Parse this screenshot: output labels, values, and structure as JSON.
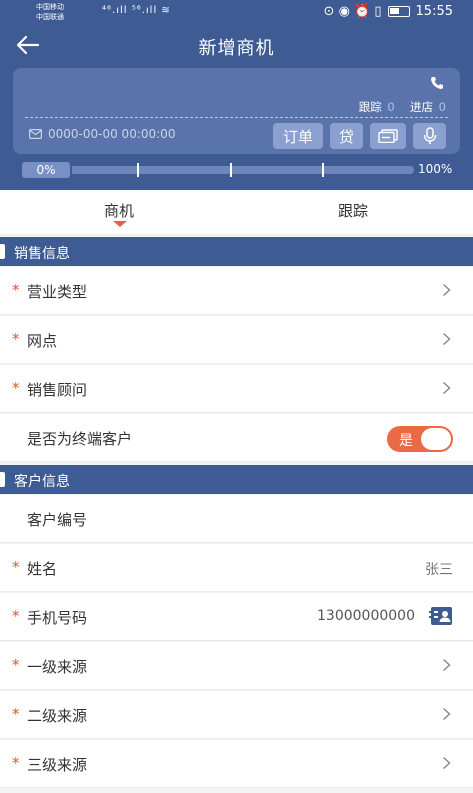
{
  "statusbar": {
    "carrier1": "中国移动",
    "carrier2": "中国联通",
    "signal_icons": "⁴⁶.ıll ⁵⁶.ıll ≋",
    "right_icons": "⊙ ◉ ⏰ ▯",
    "time": "15:55"
  },
  "header": {
    "title": "新增商机"
  },
  "card": {
    "follow_label": "跟踪",
    "follow_count": "0",
    "visit_label": "进店",
    "visit_count": "0",
    "datetime": "0000-00-00 00:00:00",
    "btn_order": "订单",
    "btn_loan": "贷"
  },
  "progress": {
    "start_label": "0%",
    "end_label": "100%",
    "value": 0
  },
  "tabs": [
    {
      "label": "商机",
      "active": true
    },
    {
      "label": "跟踪",
      "active": false
    }
  ],
  "sections": {
    "sales": "销售信息",
    "customer": "客户信息"
  },
  "rows": {
    "business_type": {
      "label": "营业类型",
      "required": "*"
    },
    "outlet": {
      "label": "网点",
      "required": "*"
    },
    "consultant": {
      "label": "销售顾问",
      "required": "*"
    },
    "end_customer": {
      "label": "是否为终端客户",
      "toggle_label": "是"
    },
    "customer_no": {
      "label": "客户编号"
    },
    "name": {
      "label": "姓名",
      "required": "*",
      "value": "张三"
    },
    "phone": {
      "label": "手机号码",
      "required": "*",
      "value": "13000000000"
    },
    "source1": {
      "label": "一级来源",
      "required": "*"
    },
    "source2": {
      "label": "二级来源",
      "required": "*"
    },
    "source3": {
      "label": "三级来源",
      "required": "*"
    }
  },
  "colors": {
    "primary": "#3f5b93",
    "accent": "#e0643f",
    "required": "#e0562f"
  }
}
